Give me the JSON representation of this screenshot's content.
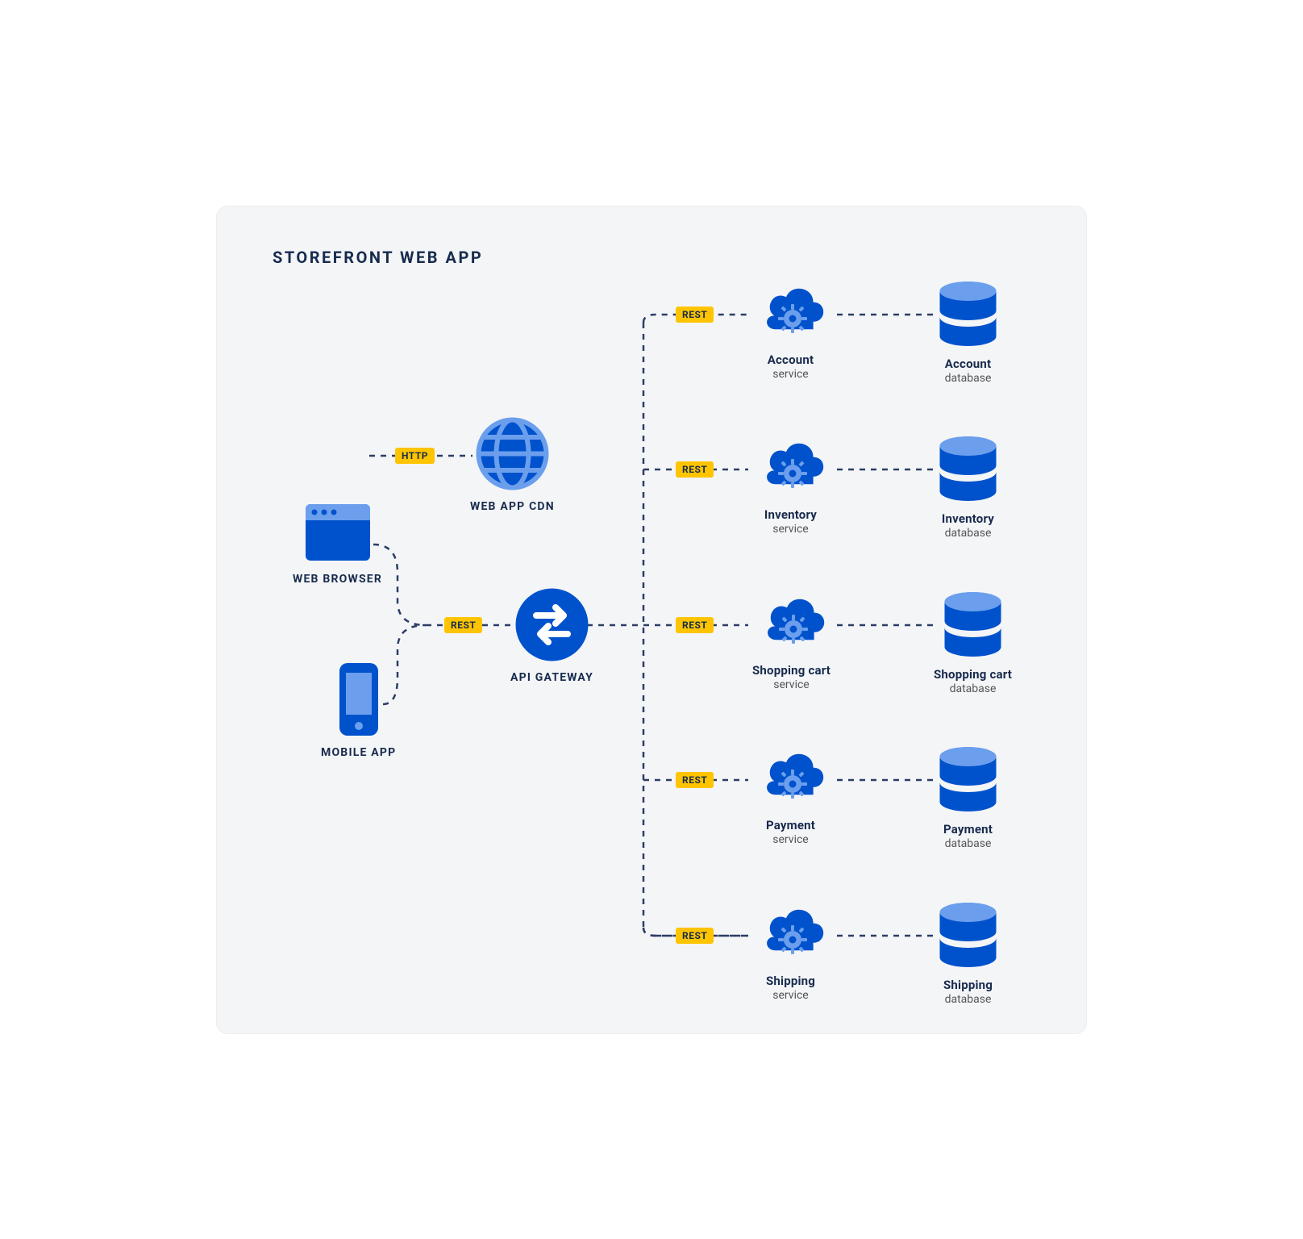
{
  "title": "STOREFRONT WEB APP",
  "colors": {
    "primaryBlue": "#0052CC",
    "lightBlue": "#6B9FED",
    "midBlue": "#4C8CE8",
    "badgeYellow": "#FFC400",
    "dashStroke": "#2C3E66",
    "textDark": "#172B4D"
  },
  "clients": {
    "webBrowser": "WEB BROWSER",
    "mobileApp": "MOBILE APP"
  },
  "cdn": {
    "label": "WEB APP CDN"
  },
  "gateway": {
    "label": "API GATEWAY"
  },
  "connections": {
    "http": "HTTP",
    "rest": "REST"
  },
  "services": [
    {
      "name": "Account",
      "service": "service",
      "db": "database"
    },
    {
      "name": "Inventory",
      "service": "service",
      "db": "database"
    },
    {
      "name": "Shopping cart",
      "service": "service",
      "db": "database"
    },
    {
      "name": "Payment",
      "service": "service",
      "db": "database"
    },
    {
      "name": "Shipping",
      "service": "service",
      "db": "database"
    }
  ]
}
